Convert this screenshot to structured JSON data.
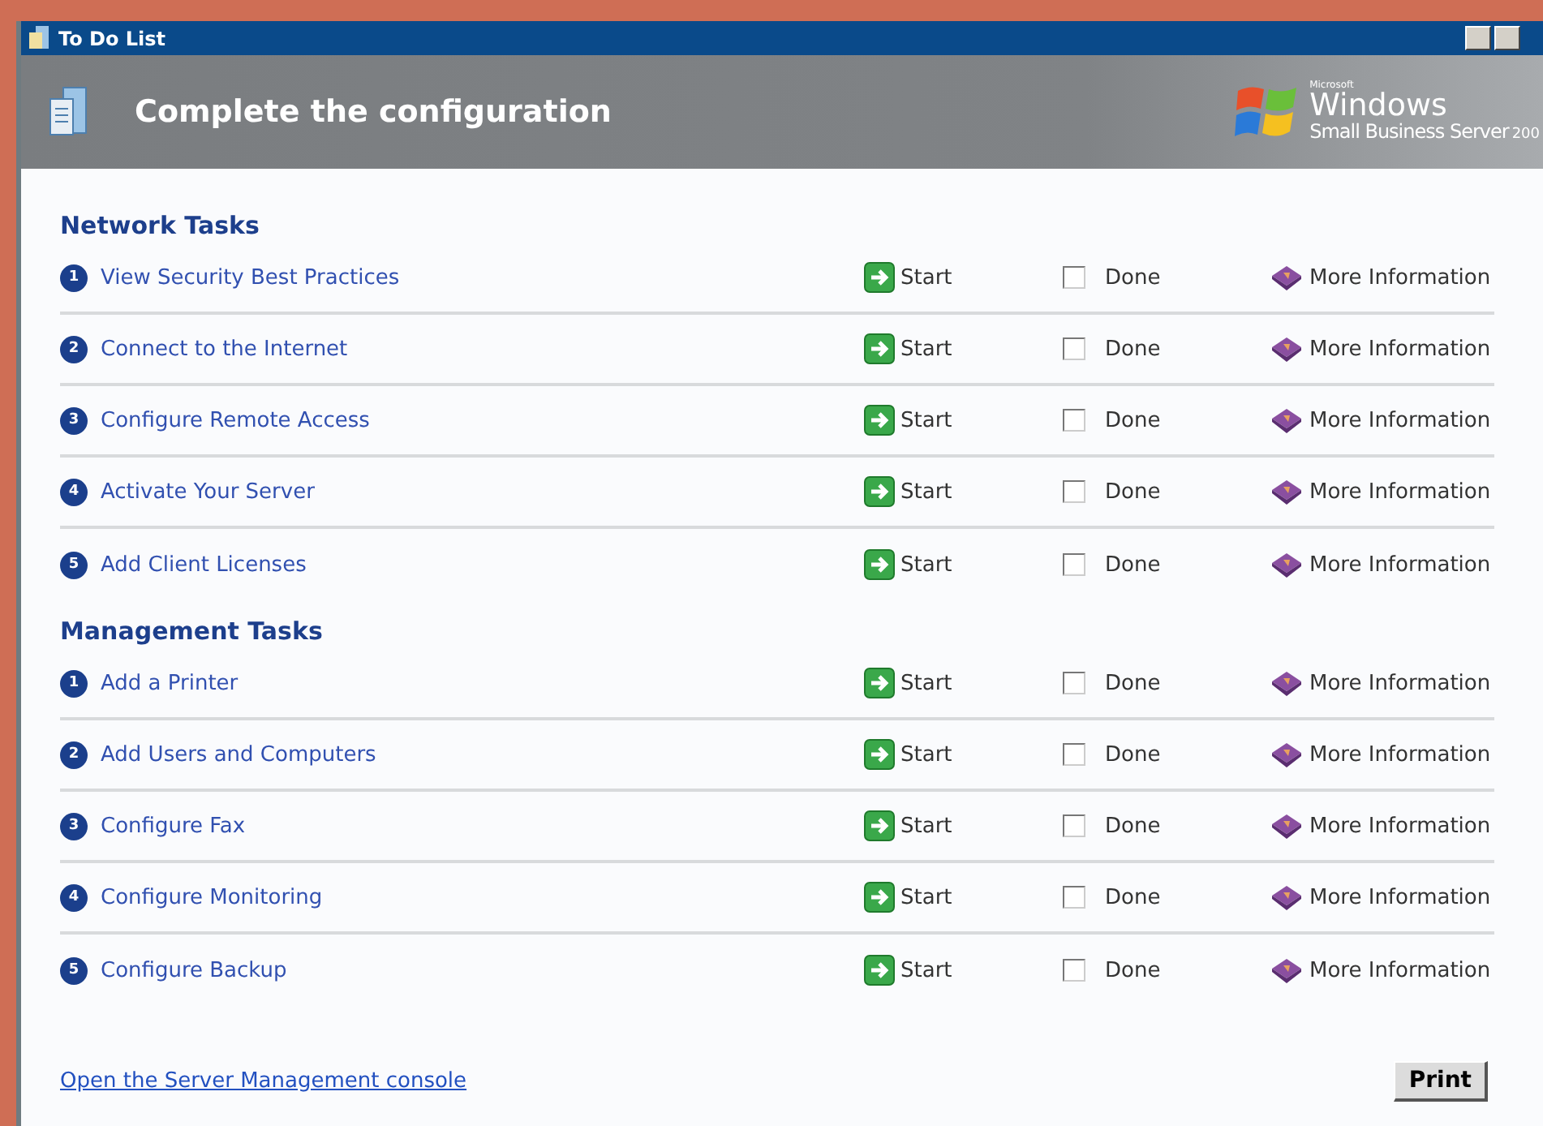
{
  "window": {
    "title": "To Do List"
  },
  "header": {
    "title": "Complete the configuration",
    "logo": {
      "maker": "Microsoft",
      "product": "Windows",
      "edition": "Small Business Server",
      "year": "200"
    }
  },
  "sections": [
    {
      "title": "Network Tasks",
      "tasks": [
        {
          "number": "1",
          "label": "View Security Best Practices",
          "start": "Start",
          "done_label": "Done",
          "done": false,
          "info": "More Information"
        },
        {
          "number": "2",
          "label": "Connect to the Internet",
          "start": "Start",
          "done_label": "Done",
          "done": false,
          "info": "More Information"
        },
        {
          "number": "3",
          "label": "Configure Remote Access",
          "start": "Start",
          "done_label": "Done",
          "done": false,
          "info": "More Information"
        },
        {
          "number": "4",
          "label": "Activate Your Server",
          "start": "Start",
          "done_label": "Done",
          "done": false,
          "info": "More Information"
        },
        {
          "number": "5",
          "label": "Add Client Licenses",
          "start": "Start",
          "done_label": "Done",
          "done": false,
          "info": "More Information"
        }
      ]
    },
    {
      "title": "Management Tasks",
      "tasks": [
        {
          "number": "1",
          "label": "Add a Printer",
          "start": "Start",
          "done_label": "Done",
          "done": false,
          "info": "More Information"
        },
        {
          "number": "2",
          "label": "Add Users and Computers",
          "start": "Start",
          "done_label": "Done",
          "done": false,
          "info": "More Information"
        },
        {
          "number": "3",
          "label": "Configure Fax",
          "start": "Start",
          "done_label": "Done",
          "done": false,
          "info": "More Information"
        },
        {
          "number": "4",
          "label": "Configure Monitoring",
          "start": "Start",
          "done_label": "Done",
          "done": false,
          "info": "More Information"
        },
        {
          "number": "5",
          "label": "Configure Backup",
          "start": "Start",
          "done_label": "Done",
          "done": false,
          "info": "More Information"
        }
      ]
    }
  ],
  "footer": {
    "link": "Open the Server Management console",
    "print": "Print"
  }
}
